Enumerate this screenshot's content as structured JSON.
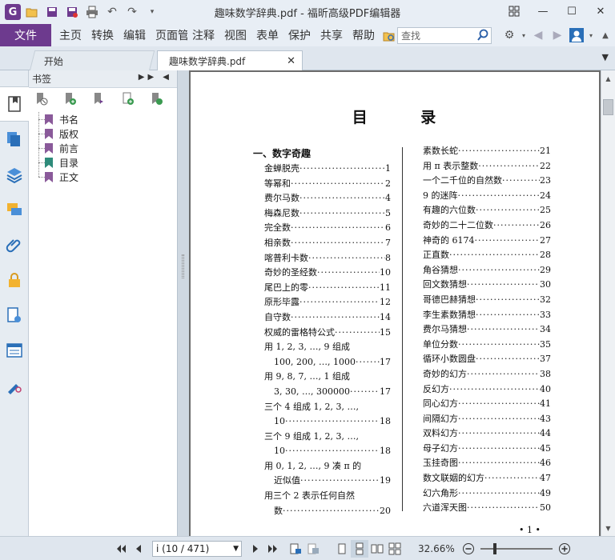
{
  "app": {
    "title": "趣味数学辞典.pdf - 福昕高级PDF编辑器",
    "logo_letter": "G"
  },
  "menu": {
    "file": "文件",
    "items": [
      "主页",
      "转换",
      "编辑",
      "页面管",
      "注释",
      "视图",
      "表单",
      "保护",
      "共享",
      "帮助"
    ],
    "search_placeholder": "查找"
  },
  "tabs": [
    {
      "label": "开始"
    },
    {
      "label": "趣味数学辞典.pdf"
    }
  ],
  "bookmarks": {
    "header": "书签",
    "items": [
      "书名",
      "版权",
      "前言",
      "目录",
      "正文"
    ]
  },
  "document": {
    "page_title": "目 录",
    "left_column": [
      {
        "type": "section",
        "text": "一、数字奇趣"
      },
      {
        "text": "金蝉脱壳",
        "page": "1"
      },
      {
        "text": "等幂和",
        "page": "2"
      },
      {
        "text": "费尔马数",
        "page": "4"
      },
      {
        "text": "梅森尼数",
        "page": "5"
      },
      {
        "text": "完全数",
        "page": "6"
      },
      {
        "text": "相亲数",
        "page": "7"
      },
      {
        "text": "喀普利卡数",
        "page": "8"
      },
      {
        "text": "奇妙的圣经数",
        "page": "10"
      },
      {
        "text": "尾巴上的零",
        "page": "11"
      },
      {
        "text": "原形毕露",
        "page": "12"
      },
      {
        "text": "自守数",
        "page": "14"
      },
      {
        "text": "权威的雷格特公式",
        "page": "15"
      },
      {
        "type": "head",
        "text": "用 1, 2, 3, …, 9 组成"
      },
      {
        "type": "cont",
        "text": "100, 200, …, 1000",
        "page": "17"
      },
      {
        "type": "head",
        "text": "用 9, 8, 7, …, 1 组成"
      },
      {
        "type": "cont",
        "text": "3, 30, …, 300000",
        "page": "17"
      },
      {
        "type": "head",
        "text": "三个 4 组成 1, 2, 3, …,"
      },
      {
        "type": "cont",
        "text": "10",
        "page": "18"
      },
      {
        "type": "head",
        "text": "三个 9 组成 1, 2, 3, …,"
      },
      {
        "type": "cont",
        "text": "10",
        "page": "18"
      },
      {
        "type": "head",
        "text": "用 0, 1, 2, …, 9 凑 π 的"
      },
      {
        "type": "cont",
        "text": "近似值",
        "page": "19"
      },
      {
        "type": "head",
        "text": "用三个 2 表示任何自然"
      },
      {
        "type": "cont",
        "text": "数",
        "page": "20"
      }
    ],
    "right_column": [
      {
        "text": "素数长蛇",
        "page": "21"
      },
      {
        "text": "用 π 表示整数",
        "page": "22"
      },
      {
        "text": "一个二千位的自然数",
        "page": "23"
      },
      {
        "text": "9 的迷阵",
        "page": "24"
      },
      {
        "text": "有趣的六位数",
        "page": "25"
      },
      {
        "text": "奇妙的二十二位数",
        "page": "26"
      },
      {
        "text": "神奇的 6174",
        "page": "27"
      },
      {
        "text": "正直数",
        "page": "28"
      },
      {
        "text": "角谷猜想",
        "page": "29"
      },
      {
        "text": "回文数猜想",
        "page": "30"
      },
      {
        "text": "哥德巴赫猜想",
        "page": "32"
      },
      {
        "text": "李生素数猜想",
        "page": "33"
      },
      {
        "text": "费尔马猜想",
        "page": "34"
      },
      {
        "text": "单位分数",
        "page": "35"
      },
      {
        "text": "循环小数圆盘",
        "page": "37"
      },
      {
        "text": "奇妙的幻方",
        "page": "38"
      },
      {
        "text": "反幻方",
        "page": "40"
      },
      {
        "text": "同心幻方",
        "page": "41"
      },
      {
        "text": "间隔幻方",
        "page": "43"
      },
      {
        "text": "双料幻方",
        "page": "44"
      },
      {
        "text": "母子幻方",
        "page": "45"
      },
      {
        "text": "玉挂奇图",
        "page": "46"
      },
      {
        "text": "数文联姻的幻方",
        "page": "47"
      },
      {
        "text": "幻六角形",
        "page": "49"
      },
      {
        "text": "六道浑天图",
        "page": "50"
      }
    ],
    "page_number": "• 1 •"
  },
  "status": {
    "page_indicator": "i (10 / 471)",
    "zoom": "32.66%"
  },
  "colors": {
    "brand": "#6d3a8e",
    "bookmark_flag": "#8a5a9a",
    "bookmark_flag_selected": "#2e8b7a"
  }
}
